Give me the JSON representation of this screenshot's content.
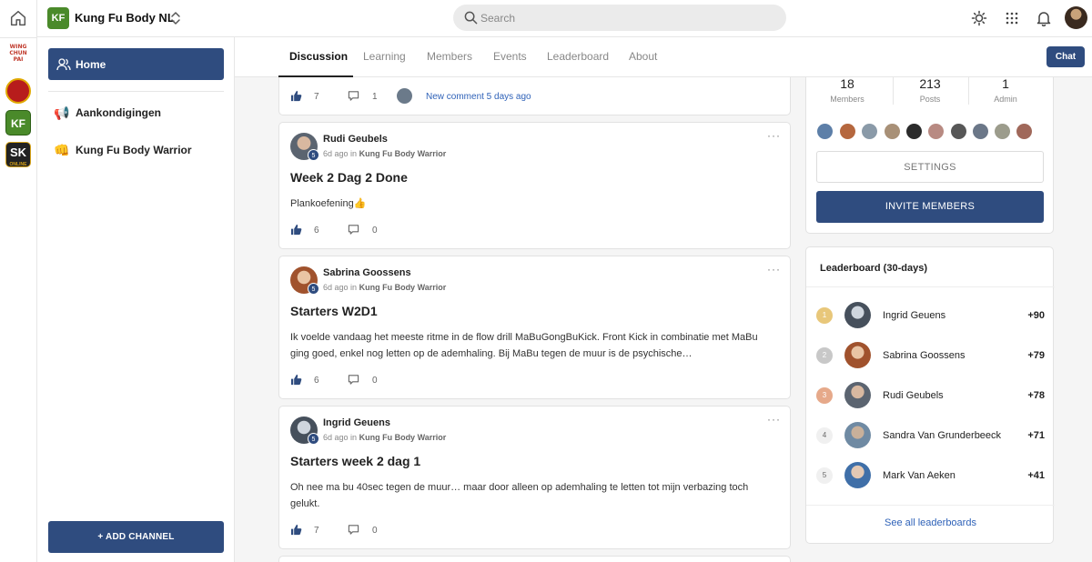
{
  "rail": {
    "logos": [
      {
        "name": "wing-chun-pai-logo",
        "text": "WING CHUN PAI"
      },
      {
        "name": "red-emblem-logo"
      },
      {
        "name": "kung-fu-body-logo",
        "text": "KF"
      },
      {
        "name": "sk-online-logo",
        "text": "SK",
        "sub": "ONLINE"
      }
    ]
  },
  "header": {
    "community_name": "Kung Fu Body NL",
    "logo_text": "KF",
    "search_placeholder": "Search"
  },
  "sidebar": {
    "home_label": "Home",
    "channels": [
      {
        "label": "Aankondigingen",
        "icon": "megaphone-icon",
        "glyph": "📢"
      },
      {
        "label": "Kung Fu Body Warrior",
        "icon": "fist-icon",
        "glyph": "👊"
      }
    ],
    "add_channel_label": "+ ADD CHANNEL"
  },
  "tabs": [
    "Discussion",
    "Learning",
    "Members",
    "Events",
    "Leaderboard",
    "About"
  ],
  "chat_label": "Chat",
  "top_post": {
    "likes": "7",
    "comments": "1",
    "new_comment": "New comment 5 days ago"
  },
  "posts": [
    {
      "author": "Rudi Geubels",
      "level": "5",
      "time": "6d ago",
      "in_word": "in",
      "channel": "Kung Fu Body Warrior",
      "title": "Week 2 Dag 2 Done",
      "body": "Plankoefening👍",
      "likes": "6",
      "comments": "0"
    },
    {
      "author": "Sabrina Goossens",
      "level": "5",
      "time": "6d ago",
      "in_word": "in",
      "channel": "Kung Fu Body Warrior",
      "title": "Starters W2D1",
      "body": "Ik voelde vandaag het meeste ritme in de flow drill MaBuGongBuKick. Front Kick in combinatie met MaBu ging goed, enkel nog letten op de ademhaling. Bij MaBu tegen de muur is de psychische…",
      "likes": "6",
      "comments": "0"
    },
    {
      "author": "Ingrid Geuens",
      "level": "5",
      "time": "6d ago",
      "in_word": "in",
      "channel": "Kung Fu Body Warrior",
      "title": "Starters week 2 dag 1",
      "body": "Oh nee ma bu 40sec tegen de muur… maar door alleen op ademhaling te letten tot mijn verbazing toch gelukt.",
      "likes": "7",
      "comments": "0"
    }
  ],
  "stats": [
    {
      "value": "18",
      "label": "Members"
    },
    {
      "value": "213",
      "label": "Posts"
    },
    {
      "value": "1",
      "label": "Admin"
    }
  ],
  "settings_label": "SETTINGS",
  "invite_label": "INVITE MEMBERS",
  "leaderboard": {
    "title": "Leaderboard (30-days)",
    "rows": [
      {
        "rank": "1",
        "name": "Ingrid Geuens",
        "score": "+90"
      },
      {
        "rank": "2",
        "name": "Sabrina Goossens",
        "score": "+79"
      },
      {
        "rank": "3",
        "name": "Rudi Geubels",
        "score": "+78"
      },
      {
        "rank": "4",
        "name": "Sandra Van Grunderbeeck",
        "score": "+71"
      },
      {
        "rank": "5",
        "name": "Mark Van Aeken",
        "score": "+41"
      }
    ],
    "see_all": "See all leaderboards"
  },
  "colors": {
    "accent": "#2f4c7f",
    "link": "#2f62b8",
    "gold": "#e8c77a",
    "silver": "#c8c8c8",
    "bronze": "#e6a98a"
  }
}
